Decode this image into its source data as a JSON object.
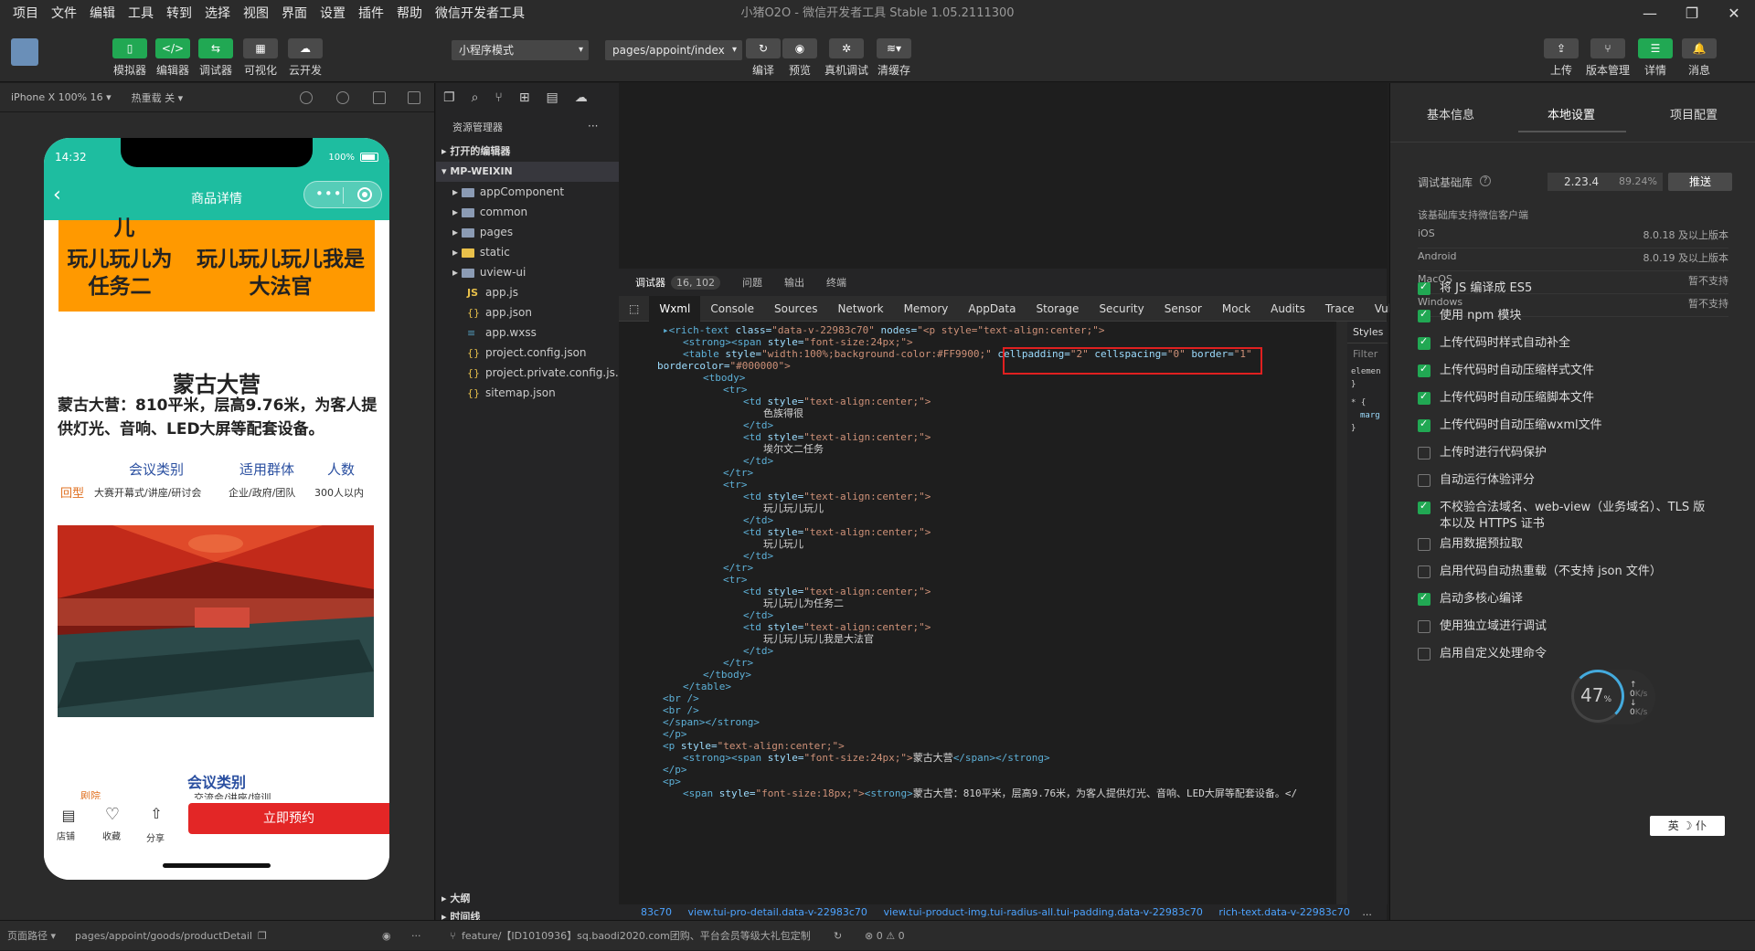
{
  "menu": [
    "项目",
    "文件",
    "编辑",
    "工具",
    "转到",
    "选择",
    "视图",
    "界面",
    "设置",
    "插件",
    "帮助",
    "微信开发者工具"
  ],
  "window_title": "小猪O2O - 微信开发者工具 Stable 1.05.2111300",
  "toolbar": {
    "simulator": "模拟器",
    "editor": "编辑器",
    "debugger": "调试器",
    "visual": "可视化",
    "cloud": "云开发",
    "mode": "小程序模式",
    "page_path": "pages/appoint/index",
    "compile": "编译",
    "preview": "预览",
    "real_debug": "真机调试",
    "clear_cache": "清缓存",
    "upload": "上传",
    "version": "版本管理",
    "detail": "详情",
    "message": "消息"
  },
  "simbar": {
    "device": "iPhone X 100% 16 ▾",
    "hot_reload": "热重载 关 ▾"
  },
  "phone": {
    "time": "14:32",
    "battery": "100%",
    "nav_title": "商品详情",
    "cell_top": "儿",
    "cell1": "玩儿玩儿为任务二",
    "cell2": "玩儿玩儿玩儿我是大法官",
    "title": "蒙古大营",
    "desc": "蒙古大营：810平米，层高9.76米，为客人提供灯光、音响、LED大屏等配套设备。",
    "col1": "会议类别",
    "col2": "适用群体",
    "col3": "人数",
    "tag": "回型",
    "v1": "大赛开幕式/讲座/研讨会",
    "v2": "企业/政府/团队",
    "v3": "300人以内",
    "section": "会议类别",
    "partial1": "剧院",
    "partial2": "交流会/讲座/培训",
    "shop": "店铺",
    "fav": "收藏",
    "share": "分享",
    "book": "立即预约"
  },
  "explorer": {
    "title": "资源管理器",
    "open_editors": "打开的编辑器",
    "project": "MP-WEIXIN",
    "items": [
      "appComponent",
      "common",
      "pages",
      "static",
      "uview-ui",
      "app.js",
      "app.json",
      "app.wxss",
      "project.config.json",
      "project.private.config.js...",
      "sitemap.json"
    ],
    "outline": "大纲",
    "timeline": "时间线"
  },
  "devtools": {
    "tabs": [
      "调试器",
      "16, 102",
      "问题",
      "输出",
      "终端"
    ],
    "panels": [
      "Wxml",
      "Console",
      "Sources",
      "Network",
      "Memory",
      "AppData",
      "Storage",
      "Security",
      "Sensor",
      "Mock",
      "Audits",
      "Trace",
      "Vulnera"
    ],
    "styles_tab": "Styles",
    "filter": "Filter",
    "styles_lines": [
      "elemen",
      "}",
      "* {",
      "marg",
      "}"
    ],
    "breadcrumb": [
      "83c70",
      "view.tui-pro-detail.data-v-22983c70",
      "view.tui-product-img.tui-radius-all.tui-padding.data-v-22983c70",
      "rich-text.data-v-22983c70",
      "..."
    ]
  },
  "code_lines": [
    {
      "i": 0,
      "t": [
        [
          "tag",
          "▸<rich-text "
        ],
        [
          "attr",
          "class="
        ],
        [
          "val",
          "\"data-v-22983c70\" "
        ],
        [
          "attr",
          "nodes="
        ],
        [
          "val",
          "\"<p style=\"text-align:center;\">"
        ]
      ]
    },
    {
      "i": 1,
      "t": [
        [
          "tag",
          "<strong><span "
        ],
        [
          "attr",
          "style="
        ],
        [
          "val",
          "\"font-size:24px;\">"
        ]
      ]
    },
    {
      "i": 1,
      "t": [
        [
          "tag",
          "<table "
        ],
        [
          "attr",
          "style="
        ],
        [
          "val",
          "\"width:100%;background-color:#FF9900;\" "
        ],
        [
          "attr",
          "cellpadding="
        ],
        [
          "val",
          "\"2\" "
        ],
        [
          "attr",
          "cellspacing="
        ],
        [
          "val",
          "\"0\" "
        ],
        [
          "attr",
          "border="
        ],
        [
          "val",
          "\"1\""
        ]
      ]
    },
    {
      "i": -1,
      "t": [
        [
          "attr",
          "bordercolor="
        ],
        [
          "val",
          "\"#000000\">"
        ]
      ]
    },
    {
      "i": 2,
      "t": [
        [
          "tag",
          "<tbody>"
        ]
      ]
    },
    {
      "i": 3,
      "t": [
        [
          "tag",
          "<tr>"
        ]
      ]
    },
    {
      "i": 4,
      "t": [
        [
          "tag",
          "<td "
        ],
        [
          "attr",
          "style="
        ],
        [
          "val",
          "\"text-align:center;\">"
        ]
      ]
    },
    {
      "i": 5,
      "t": [
        [
          "txt",
          "色族得很"
        ]
      ]
    },
    {
      "i": 4,
      "t": [
        [
          "tag",
          "</td>"
        ]
      ]
    },
    {
      "i": 4,
      "t": [
        [
          "tag",
          "<td "
        ],
        [
          "attr",
          "style="
        ],
        [
          "val",
          "\"text-align:center;\">"
        ]
      ]
    },
    {
      "i": 5,
      "t": [
        [
          "txt",
          "埃尔文二任务"
        ]
      ]
    },
    {
      "i": 4,
      "t": [
        [
          "tag",
          "</td>"
        ]
      ]
    },
    {
      "i": 3,
      "t": [
        [
          "tag",
          "</tr>"
        ]
      ]
    },
    {
      "i": 3,
      "t": [
        [
          "tag",
          "<tr>"
        ]
      ]
    },
    {
      "i": 4,
      "t": [
        [
          "tag",
          "<td "
        ],
        [
          "attr",
          "style="
        ],
        [
          "val",
          "\"text-align:center;\">"
        ]
      ]
    },
    {
      "i": 5,
      "t": [
        [
          "txt",
          "玩儿玩儿玩儿"
        ]
      ]
    },
    {
      "i": 4,
      "t": [
        [
          "tag",
          "</td>"
        ]
      ]
    },
    {
      "i": 4,
      "t": [
        [
          "tag",
          "<td "
        ],
        [
          "attr",
          "style="
        ],
        [
          "val",
          "\"text-align:center;\">"
        ]
      ]
    },
    {
      "i": 5,
      "t": [
        [
          "txt",
          "玩儿玩儿"
        ]
      ]
    },
    {
      "i": 4,
      "t": [
        [
          "tag",
          "</td>"
        ]
      ]
    },
    {
      "i": 3,
      "t": [
        [
          "tag",
          "</tr>"
        ]
      ]
    },
    {
      "i": 3,
      "t": [
        [
          "tag",
          "<tr>"
        ]
      ]
    },
    {
      "i": 4,
      "t": [
        [
          "tag",
          "<td "
        ],
        [
          "attr",
          "style="
        ],
        [
          "val",
          "\"text-align:center;\">"
        ]
      ]
    },
    {
      "i": 5,
      "t": [
        [
          "txt",
          "玩儿玩儿为任务二"
        ]
      ]
    },
    {
      "i": 4,
      "t": [
        [
          "tag",
          "</td>"
        ]
      ]
    },
    {
      "i": 4,
      "t": [
        [
          "tag",
          "<td "
        ],
        [
          "attr",
          "style="
        ],
        [
          "val",
          "\"text-align:center;\">"
        ]
      ]
    },
    {
      "i": 5,
      "t": [
        [
          "txt",
          "玩儿玩儿玩儿我是大法官"
        ]
      ]
    },
    {
      "i": 4,
      "t": [
        [
          "tag",
          "</td>"
        ]
      ]
    },
    {
      "i": 3,
      "t": [
        [
          "tag",
          "</tr>"
        ]
      ]
    },
    {
      "i": 2,
      "t": [
        [
          "tag",
          "</tbody>"
        ]
      ]
    },
    {
      "i": 1,
      "t": [
        [
          "tag",
          "</table>"
        ]
      ]
    },
    {
      "i": 0,
      "t": [
        [
          "tag",
          "<br />"
        ]
      ]
    },
    {
      "i": 0,
      "t": [
        [
          "tag",
          "<br />"
        ]
      ]
    },
    {
      "i": 0,
      "t": [
        [
          "tag",
          "</span></strong>"
        ]
      ]
    },
    {
      "i": 0,
      "t": [
        [
          "tag",
          "</p>"
        ]
      ]
    },
    {
      "i": 0,
      "t": [
        [
          "tag",
          "<p "
        ],
        [
          "attr",
          "style="
        ],
        [
          "val",
          "\"text-align:center;\">"
        ]
      ]
    },
    {
      "i": 1,
      "t": [
        [
          "tag",
          "<strong><span "
        ],
        [
          "attr",
          "style="
        ],
        [
          "val",
          "\"font-size:24px;\">"
        ],
        [
          "txt",
          "蒙古大营"
        ],
        [
          "tag",
          "</span></strong>"
        ]
      ]
    },
    {
      "i": 0,
      "t": [
        [
          "tag",
          "</p>"
        ]
      ]
    },
    {
      "i": 0,
      "t": [
        [
          "tag",
          "<p>"
        ]
      ]
    },
    {
      "i": 1,
      "t": [
        [
          "tag",
          "<span "
        ],
        [
          "attr",
          "style="
        ],
        [
          "val",
          "\"font-size:18px;\">"
        ],
        [
          "tag",
          "<strong>"
        ],
        [
          "txt",
          "蒙古大营：810平米，层高9.76米，为客人提供灯光、音响、LED大屏等配套设备。</"
        ]
      ]
    }
  ],
  "right": {
    "tabs": [
      "基本信息",
      "本地设置",
      "项目配置"
    ],
    "lib_label": "调试基础库",
    "lib_version": "2.23.4",
    "lib_pct": "89.24%",
    "push": "推送",
    "lib_note": "该基础库支持微信客户端",
    "platforms": [
      [
        "iOS",
        "8.0.18 及以上版本"
      ],
      [
        "Android",
        "8.0.19 及以上版本"
      ],
      [
        "MacOS",
        "暂不支持"
      ],
      [
        "Windows",
        "暂不支持"
      ]
    ],
    "options": [
      {
        "label": "将 JS 编译成 ES5",
        "on": true
      },
      {
        "label": "使用 npm 模块",
        "on": true
      },
      {
        "label": "上传代码时样式自动补全",
        "on": true
      },
      {
        "label": "上传代码时自动压缩样式文件",
        "on": true
      },
      {
        "label": "上传代码时自动压缩脚本文件",
        "on": true
      },
      {
        "label": "上传代码时自动压缩wxml文件",
        "on": true
      },
      {
        "label": "上传时进行代码保护",
        "on": false
      },
      {
        "label": "自动运行体验评分",
        "on": false
      },
      {
        "label": "不校验合法域名、web-view（业务域名）、TLS 版本以及 HTTPS 证书",
        "on": true
      },
      {
        "label": "启用数据预拉取",
        "on": false
      },
      {
        "label": "启用代码自动热重载（不支持 json 文件）",
        "on": false
      },
      {
        "label": "启动多核心编译",
        "on": true
      },
      {
        "label": "使用独立域进行调试",
        "on": false
      },
      {
        "label": "启用自定义处理命令",
        "on": false
      }
    ],
    "gauge": "47",
    "gauge_unit": "%",
    "up": "0",
    "down": "0",
    "speed_unit": "K/s",
    "ime": "英 ☽ 仆"
  },
  "status": {
    "path_label": "页面路径 ▾",
    "path": "pages/appoint/goods/productDetail",
    "branch": "feature/【ID1010936】sq.baodi2020.com团购、平台会员等级大礼包定制",
    "errors": "⊗ 0 ⚠ 0"
  }
}
